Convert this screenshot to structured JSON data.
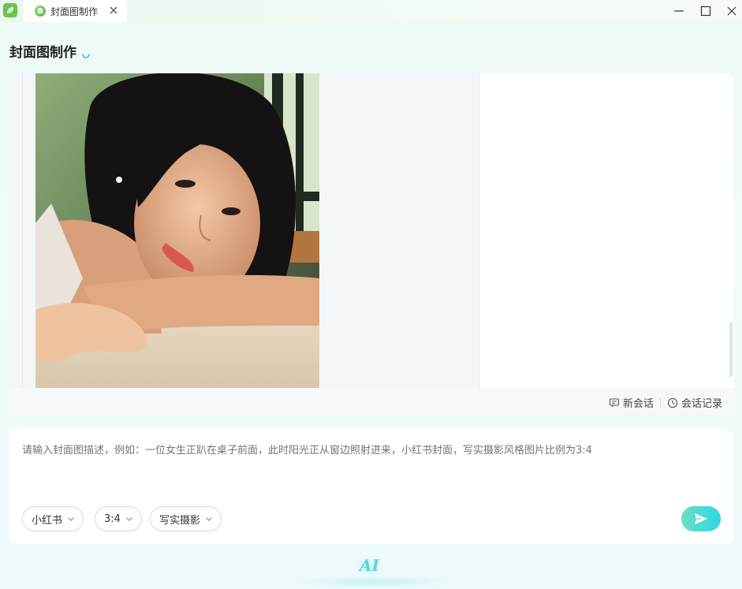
{
  "window": {
    "tab_title": "封面图制作",
    "tab_icon_text": "图"
  },
  "page": {
    "title": "封面图制作"
  },
  "chat": {
    "image_alt": "一位女生趴在桌子前面，阳光从窗边照射进来",
    "actions": {
      "new_chat": "新会话",
      "history": "会话记录"
    }
  },
  "input": {
    "placeholder": "请输入封面图描述，例如：一位女生正趴在桌子前面，此时阳光正从窗边照射进来，小红书封面，写实摄影风格图片比例为3:4",
    "platform": "小红书",
    "ratio": "3:4",
    "style": "写实摄影"
  },
  "footer": {
    "ai_label": "AI"
  },
  "colors": {
    "accent_start": "#6be0c0",
    "accent_end": "#2fd6e6",
    "brand_green": "#6cc24a"
  }
}
